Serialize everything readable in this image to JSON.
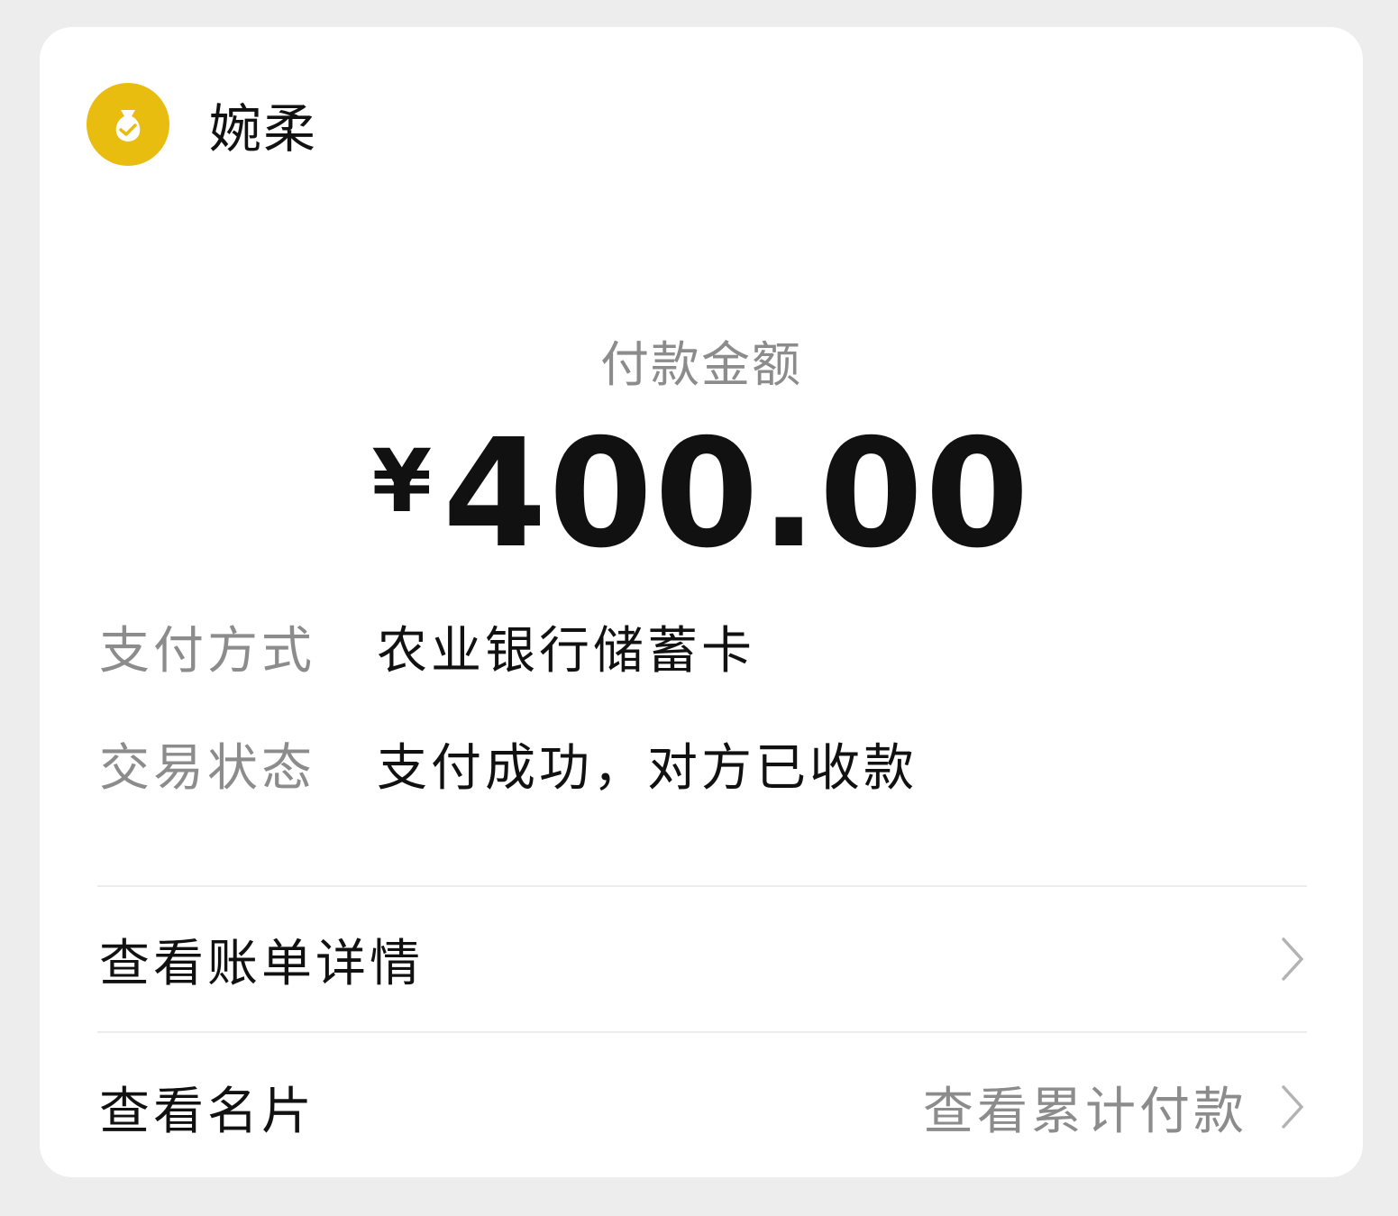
{
  "merchant": {
    "name": "婉柔",
    "icon": "money-bag-check-icon",
    "icon_color": "#e8bd10"
  },
  "payment": {
    "amount_label": "付款金额",
    "currency_symbol": "¥",
    "amount": "400.00"
  },
  "details": [
    {
      "label": "支付方式",
      "value": "农业银行储蓄卡"
    },
    {
      "label": "交易状态",
      "value": "支付成功，对方已收款"
    }
  ],
  "actions": {
    "bill_details": "查看账单详情",
    "business_card": "查看名片",
    "cumulative_payments": "查看累计付款"
  }
}
